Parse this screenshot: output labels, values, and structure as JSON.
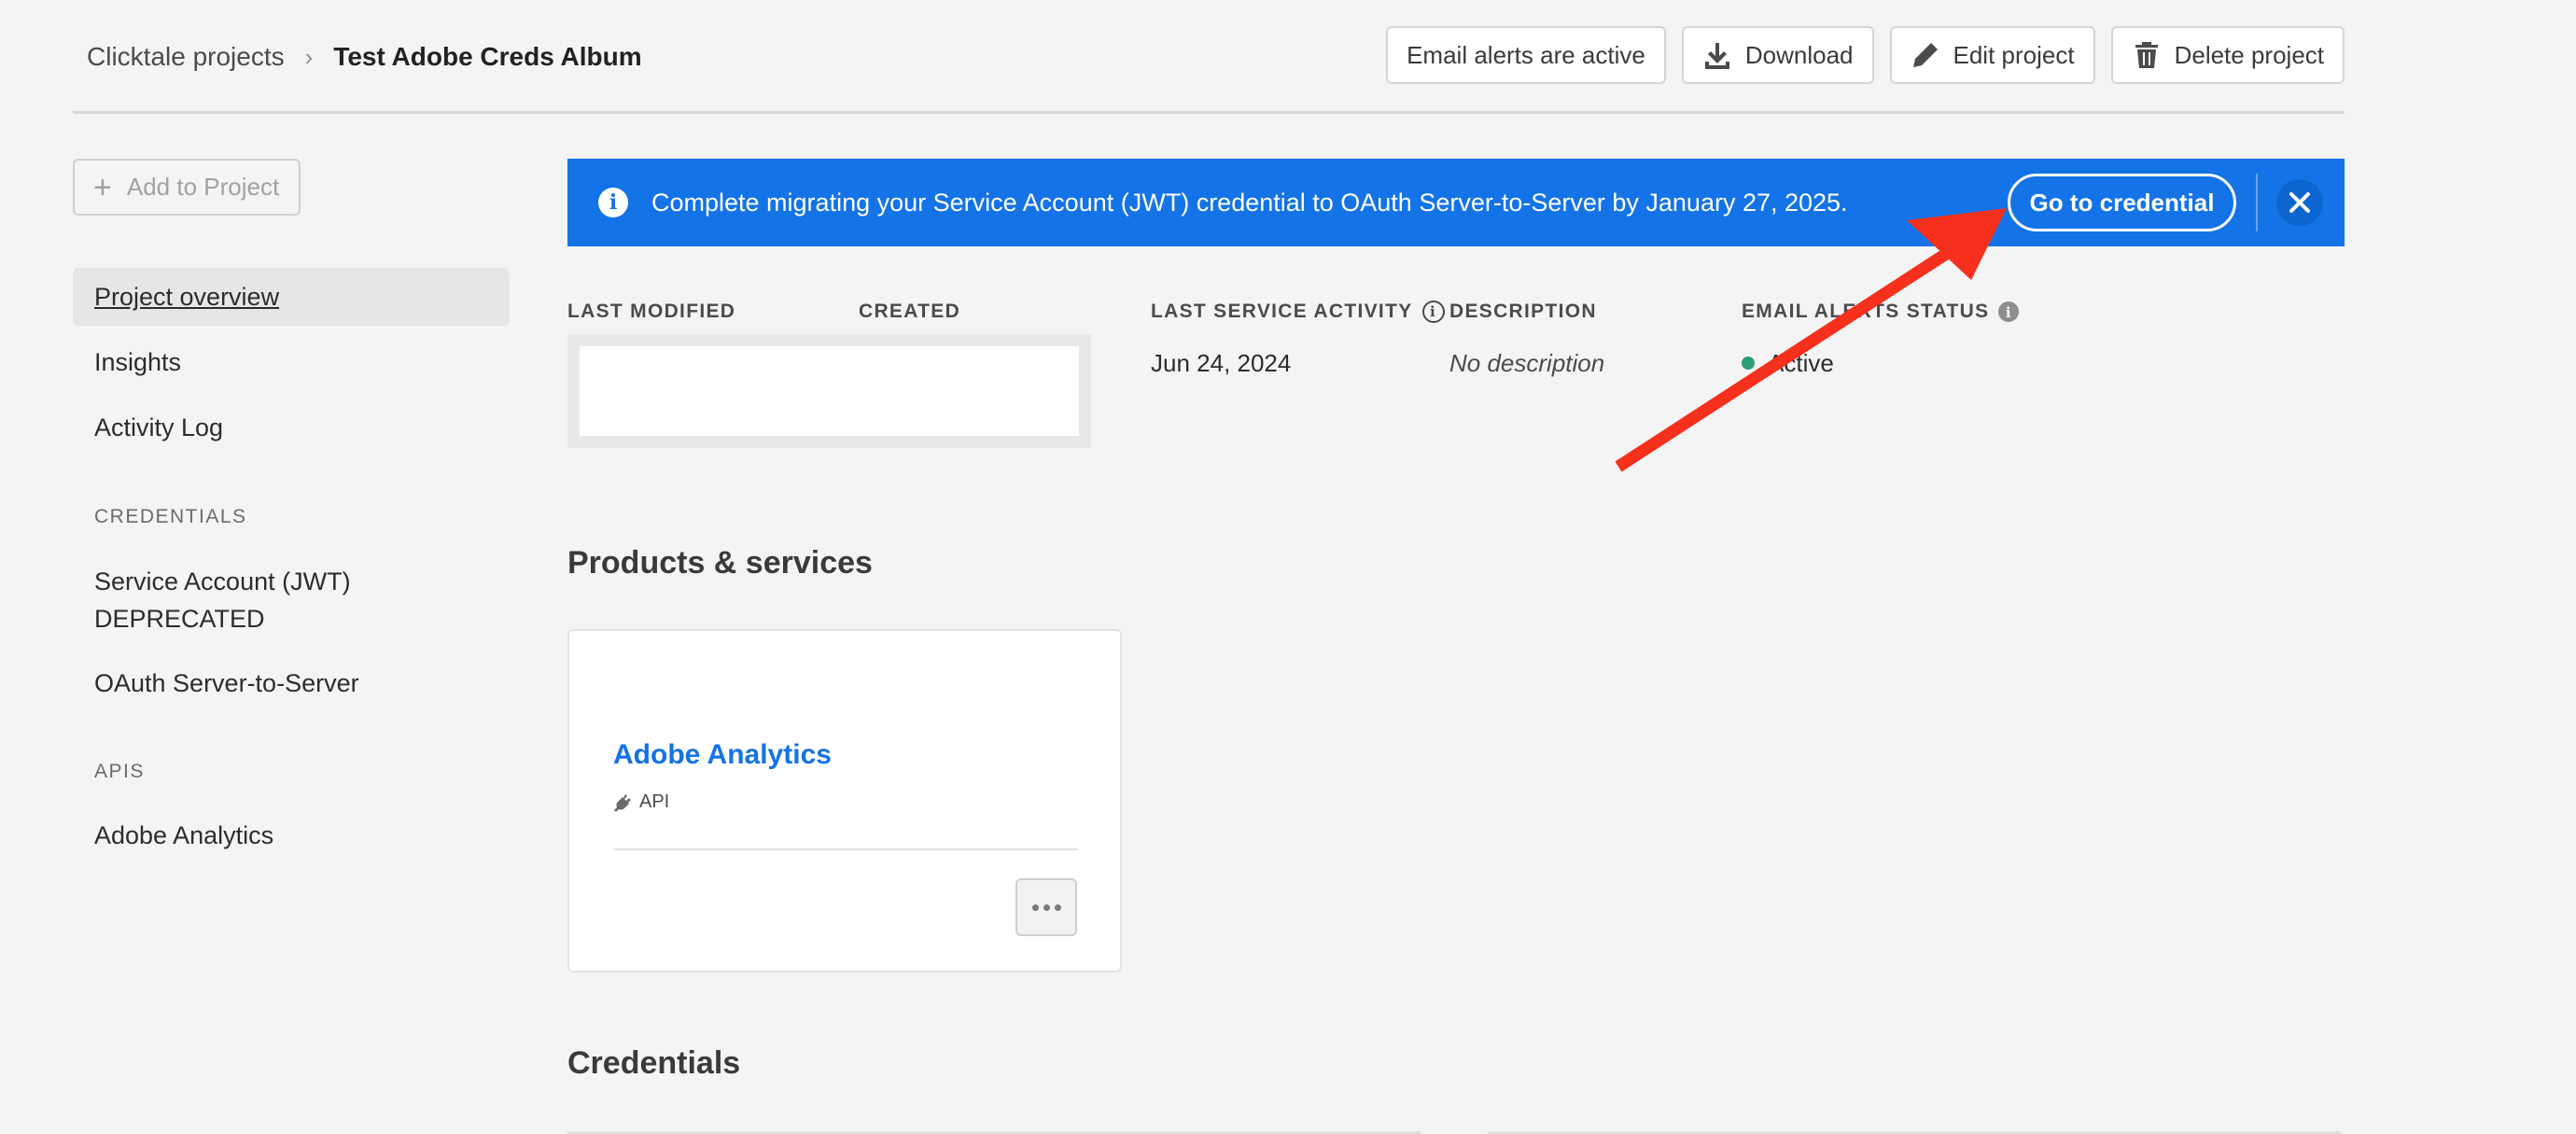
{
  "header": {
    "breadcrumb_root": "Clicktale projects",
    "breadcrumb_separator": "›",
    "breadcrumb_current": "Test Adobe Creds Album",
    "actions": {
      "email_alerts": "Email alerts are active",
      "download": "Download",
      "edit": "Edit project",
      "delete": "Delete project"
    }
  },
  "sidebar": {
    "add_button": "Add to Project",
    "items": {
      "overview": "Project overview",
      "insights": "Insights",
      "activity": "Activity Log"
    },
    "credentials_heading": "CREDENTIALS",
    "credentials": {
      "jwt": "Service Account (JWT) DEPRECATED",
      "oauth": "OAuth Server-to-Server"
    },
    "apis_heading": "APIS",
    "apis": {
      "analytics": "Adobe Analytics"
    }
  },
  "banner": {
    "message": "Complete migrating your Service Account (JWT) credential to OAuth Server-to-Server by January 27, 2025.",
    "cta": "Go to credential",
    "info_glyph": "i",
    "color": "#1473e6"
  },
  "overview": {
    "last_modified_label": "LAST MODIFIED",
    "created_label": "CREATED",
    "last_activity_label": "LAST SERVICE ACTIVITY",
    "last_activity_value": "Jun 24, 2024",
    "description_label": "DESCRIPTION",
    "description_value": "No description",
    "email_status_label": "EMAIL ALERTS STATUS",
    "email_status_value": "Active",
    "status_color": "#2d9d78"
  },
  "products": {
    "title": "Products & services",
    "card": {
      "name": "Adobe Analytics",
      "tag": "API"
    }
  },
  "credentials_section": {
    "title": "Credentials"
  },
  "annotation": {
    "arrow_color": "#f5301c"
  }
}
